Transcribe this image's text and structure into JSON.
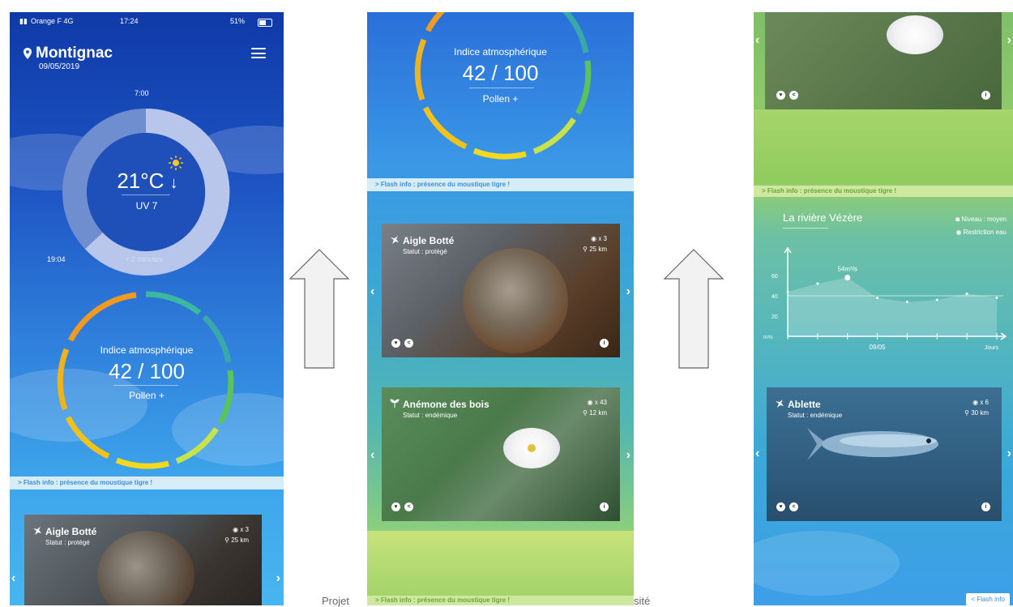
{
  "screen1": {
    "status": {
      "carrier": "Orange F 4G",
      "time": "17:24",
      "battery": "51%"
    },
    "location": "Montignac",
    "date": "09/05/2019",
    "sunrise": "7:00",
    "sunset": "19:04",
    "daylight_delta": "+ 2 minutes",
    "temperature": "21°C",
    "uv": "UV 7",
    "atmo": {
      "title": "Indice atmosphérique",
      "value": "42 / 100",
      "sub": "Pollen +"
    },
    "flash": "> Flash info : présence du moustique tigre !",
    "card": {
      "title": "Aigle Botté",
      "status": "Statut : protégé",
      "eye": "x 3",
      "dist": "25 km"
    }
  },
  "screen2": {
    "atmo": {
      "title": "Indice atmosphérique",
      "value": "42 / 100",
      "sub": "Pollen +"
    },
    "flash": "> Flash info : présence du moustique tigre !",
    "card1": {
      "title": "Aigle Botté",
      "status": "Statut : protégé",
      "eye": "x 3",
      "dist": "25 km"
    },
    "card2": {
      "title": "Anémone des bois",
      "status": "Statut : endémique",
      "eye": "x 43",
      "dist": "12 km"
    },
    "flash_bottom": "> Flash info : présence du moustique tigre !"
  },
  "screen3": {
    "flash": "> Flash info : présence du moustique tigre !",
    "river": {
      "title": "La rivière Vézère",
      "level": "Niveau : moyen",
      "restriction": "Restriction eau"
    },
    "card": {
      "title": "Ablette",
      "status": "Statut : endémique",
      "eye": "x 6",
      "dist": "30 km"
    },
    "back": "< Flash info"
  },
  "caption": {
    "left": "Projet",
    "right": "sité"
  },
  "chart_data": {
    "type": "area",
    "x": [
      "",
      "",
      "",
      "09/05",
      "",
      "",
      "",
      ""
    ],
    "values": [
      44,
      52,
      58,
      38,
      34,
      36,
      42,
      38
    ],
    "annotation": "54m³/s",
    "yticks": [
      "60",
      "40",
      "20"
    ],
    "yunit": "m³/s",
    "xlabel": "Jours",
    "ylim": [
      0,
      80
    ]
  },
  "colors": {
    "ring_track": "#7f9fd8",
    "ring_fill": "#b8c6ec",
    "flash_text": "#3d8fd0"
  }
}
